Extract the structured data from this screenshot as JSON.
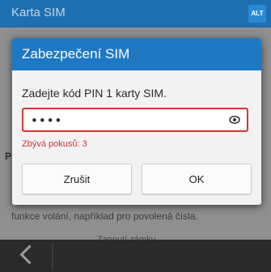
{
  "background": {
    "title": "Karta SIM",
    "alt_badge": "ALT",
    "side_letter": "P",
    "text_line": "funkce volání, například pro povolená čísla.",
    "text_line2": "Zapnutí zámku"
  },
  "dialog": {
    "title": "Zabezpečení SIM",
    "prompt": "Zadejte kód PIN 1 karty SIM.",
    "pin_mask": "••••",
    "attempts": "Zbývá pokusů: 3",
    "cancel_label": "Zrušit",
    "ok_label": "OK"
  },
  "colors": {
    "accent": "#1e78c4",
    "error": "#d23636"
  },
  "icons": {
    "reveal": "eye-icon",
    "back": "back-arrow-icon"
  }
}
